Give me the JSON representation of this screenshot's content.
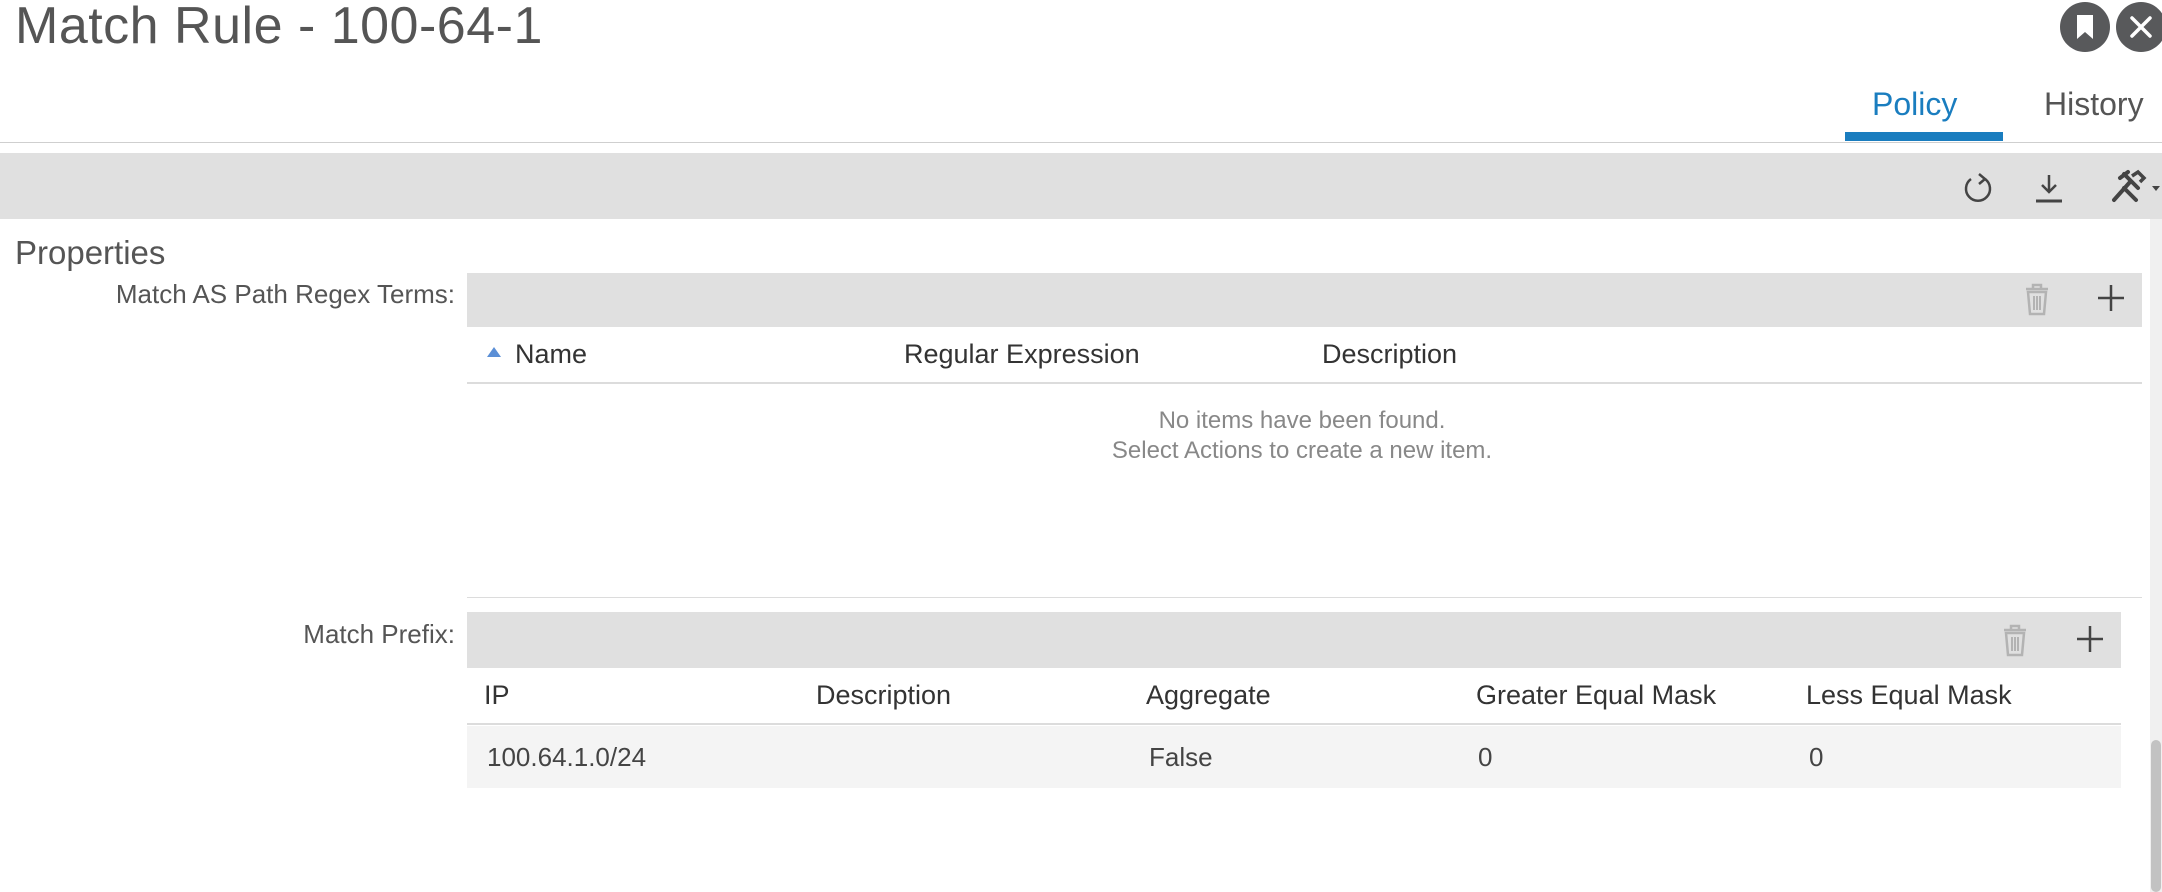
{
  "header": {
    "title": "Match Rule - 100-64-1"
  },
  "tabs": [
    {
      "label": "Policy",
      "active": true
    },
    {
      "label": "History",
      "active": false
    }
  ],
  "toolbar": {
    "icons": [
      "refresh-icon",
      "download-icon",
      "tools-icon"
    ]
  },
  "properties": {
    "title": "Properties",
    "as_path_table": {
      "label": "Match AS Path Regex Terms:",
      "columns": [
        "Name",
        "Regular Expression",
        "Description"
      ],
      "empty_line1": "No items have been found.",
      "empty_line2": "Select Actions to create a new item."
    },
    "prefix_table": {
      "label": "Match Prefix:",
      "columns": [
        "IP",
        "Description",
        "Aggregate",
        "Greater Equal Mask",
        "Less Equal Mask"
      ],
      "rows": [
        {
          "ip": "100.64.1.0/24",
          "description": "",
          "aggregate": "False",
          "ge_mask": "0",
          "le_mask": "0"
        }
      ]
    }
  },
  "colors": {
    "accent": "#1a7dbf",
    "toolbar_bg": "#e0e0e0",
    "round_button": "#58595b"
  }
}
